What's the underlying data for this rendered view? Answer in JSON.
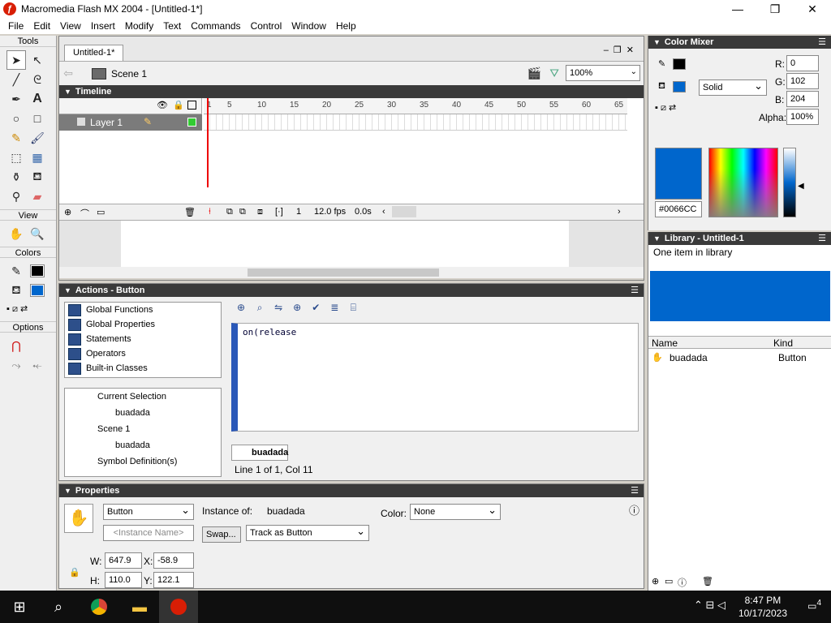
{
  "window": {
    "title": "Macromedia Flash MX 2004 - [Untitled-1*]",
    "minimize": "—",
    "maximize": "❐",
    "close": "✕"
  },
  "menu": [
    "File",
    "Edit",
    "View",
    "Insert",
    "Modify",
    "Text",
    "Commands",
    "Control",
    "Window",
    "Help"
  ],
  "tools": {
    "title": "Tools",
    "view_label": "View",
    "colors_label": "Colors",
    "options_label": "Options"
  },
  "document": {
    "tab": "Untitled-1*",
    "scene": "Scene 1",
    "zoom": "100%",
    "timeline_title": "Timeline",
    "layer_name": "Layer 1",
    "ruler": [
      "1",
      "5",
      "10",
      "15",
      "20",
      "25",
      "30",
      "35",
      "40",
      "45",
      "50",
      "55",
      "60",
      "65"
    ],
    "frame": "1",
    "fps": "12.0 fps",
    "time": "0.0s"
  },
  "actions": {
    "title": "Actions - Button",
    "toolbox": [
      "Global Functions",
      "Global Properties",
      "Statements",
      "Operators",
      "Built-in Classes"
    ],
    "tree": {
      "current_selection": "Current Selection",
      "selection_item": "buadada",
      "scene": "Scene 1",
      "scene_item": "buadada",
      "symbol_defs": "Symbol Definition(s)"
    },
    "code": "on(release",
    "script_tab": "buadada",
    "status": "Line 1 of 1, Col 11"
  },
  "properties": {
    "title": "Properties",
    "symbol_type": "Button",
    "instance_name_placeholder": "<Instance Name>",
    "instance_of_label": "Instance of:",
    "instance_of_value": "buadada",
    "swap_label": "Swap...",
    "track_mode": "Track as Button",
    "color_label": "Color:",
    "color_value": "None",
    "w_label": "W:",
    "w_value": "647.9",
    "h_label": "H:",
    "h_value": "110.0",
    "x_label": "X:",
    "x_value": "-58.9",
    "y_label": "Y:",
    "y_value": "122.1"
  },
  "color_mixer": {
    "title": "Color Mixer",
    "fill_type": "Solid",
    "r_label": "R:",
    "r_value": "0",
    "g_label": "G:",
    "g_value": "102",
    "b_label": "B:",
    "b_value": "204",
    "alpha_label": "Alpha:",
    "alpha_value": "100%",
    "hex": "#0066CC",
    "swatch_color": "#0066cc"
  },
  "library": {
    "title": "Library - Untitled-1",
    "count": "One item in library",
    "col_name": "Name",
    "col_kind": "Kind",
    "item_name": "buadada",
    "item_kind": "Button"
  },
  "taskbar": {
    "time": "8:47 PM",
    "date": "10/17/2023",
    "notifications": "4"
  }
}
